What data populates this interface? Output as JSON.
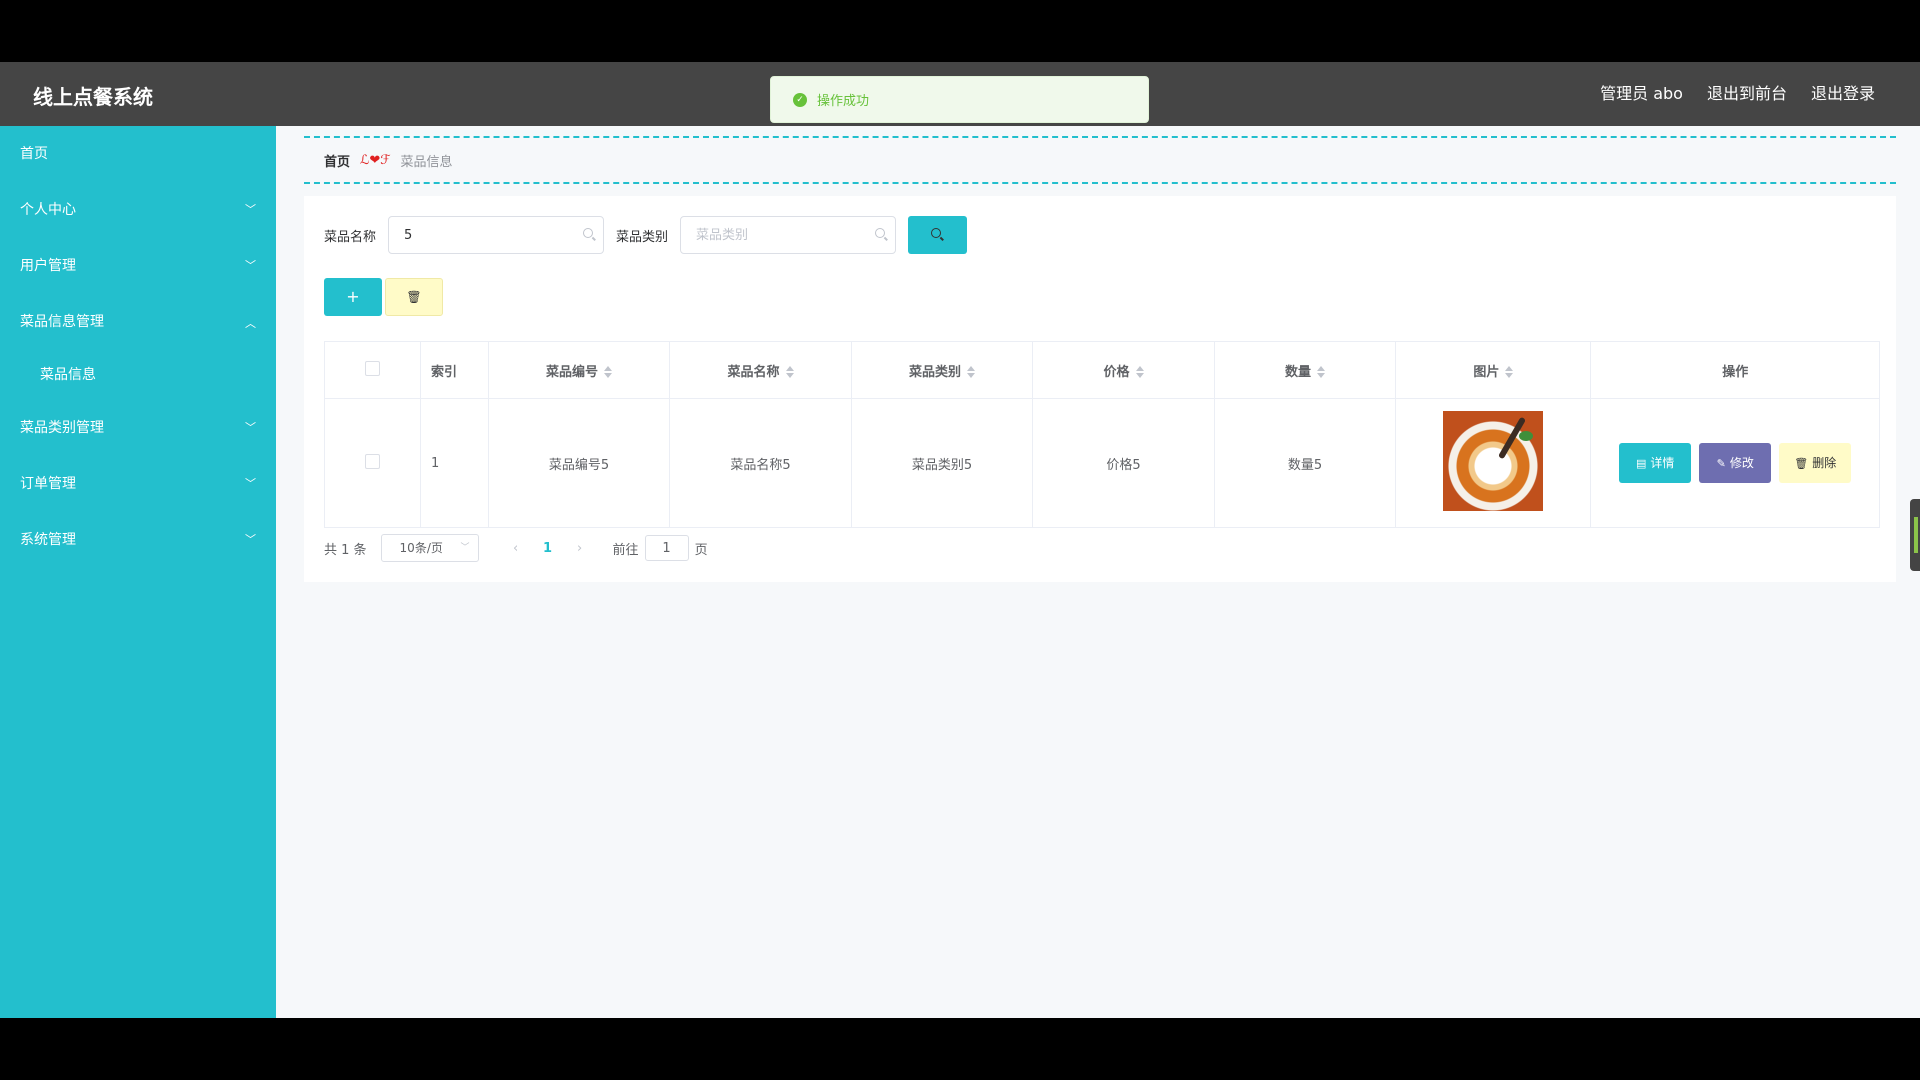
{
  "app": {
    "title": "线上点餐系统"
  },
  "header": {
    "links": [
      "管理员 abo",
      "退出到前台",
      "退出登录"
    ]
  },
  "toast": {
    "message": "操作成功",
    "icon": "check-circle-icon",
    "color": "#67c23a"
  },
  "sidebar": {
    "items": [
      {
        "label": "首页",
        "expandable": false
      },
      {
        "label": "个人中心",
        "expandable": true,
        "expanded": false
      },
      {
        "label": "用户管理",
        "expandable": true,
        "expanded": false
      },
      {
        "label": "菜品信息管理",
        "expandable": true,
        "expanded": true
      },
      {
        "label": "菜品信息",
        "submenu": true
      },
      {
        "label": "菜品类别管理",
        "expandable": true,
        "expanded": false
      },
      {
        "label": "订单管理",
        "expandable": true,
        "expanded": false
      },
      {
        "label": "系统管理",
        "expandable": true,
        "expanded": false
      }
    ]
  },
  "breadcrumb": {
    "home": "首页",
    "separator": "ℒ❤ℱ",
    "current": "菜品信息"
  },
  "search": {
    "name_label": "菜品名称",
    "name_value": "5",
    "category_label": "菜品类别",
    "category_placeholder": "菜品类别"
  },
  "table": {
    "headers": [
      "索引",
      "菜品编号",
      "菜品名称",
      "菜品类别",
      "价格",
      "数量",
      "图片",
      "操作"
    ],
    "rows": [
      {
        "index": "1",
        "code": "菜品编号5",
        "name": "菜品名称5",
        "category": "菜品类别5",
        "price": "价格5",
        "quantity": "数量5"
      }
    ],
    "actions": {
      "detail": "详情",
      "edit": "修改",
      "delete": "删除"
    }
  },
  "pager": {
    "total": "共 1 条",
    "size": "10条/页",
    "current": "1",
    "goto_label": "前往",
    "goto_value": "1",
    "page_suffix": "页"
  },
  "colors": {
    "accent": "#23bfcd",
    "header": "#454545",
    "edit": "#6e6eb0",
    "delete_bg": "#fffbc8"
  }
}
